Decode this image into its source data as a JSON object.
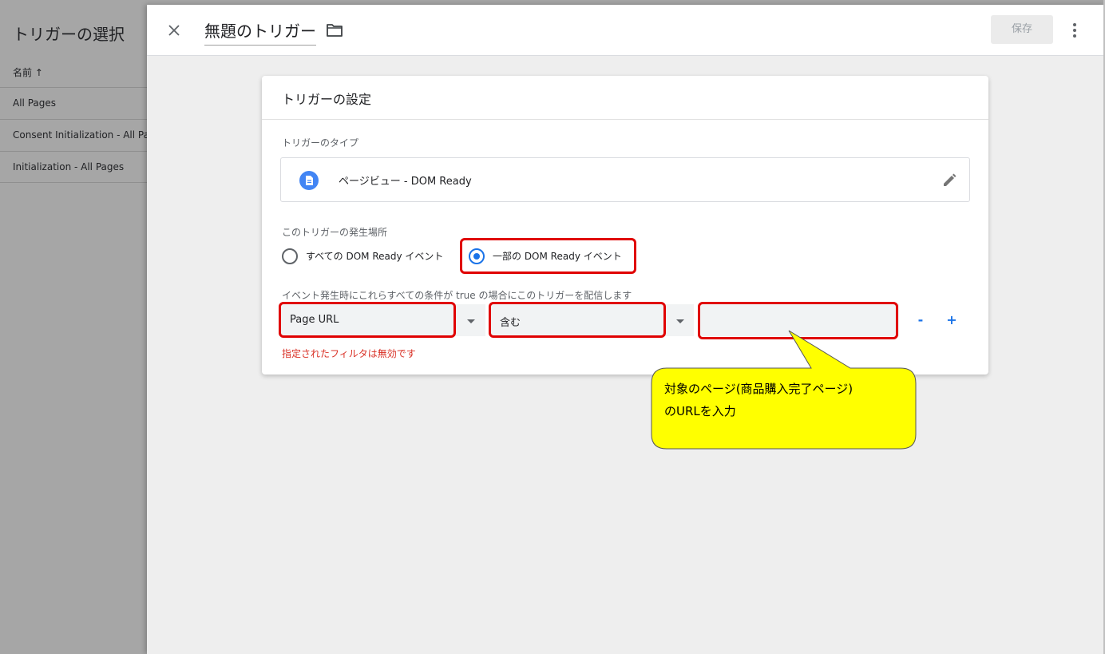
{
  "left_panel": {
    "title": "トリガーの選択",
    "column_header": "名前 ↑",
    "rows": [
      {
        "label": "All Pages"
      },
      {
        "label": "Consent Initialization - All Pages"
      },
      {
        "label": "Initialization - All Pages"
      }
    ]
  },
  "header": {
    "close_icon": "close-icon",
    "trigger_name": "無題のトリガー",
    "folder_icon": "folder-icon",
    "save_label": "保存",
    "more_icon": "more-vert-icon"
  },
  "card": {
    "title": "トリガーの設定",
    "type_label": "トリガーのタイプ",
    "type_value": "ページビュー - DOM Ready",
    "type_icon": "document-icon",
    "edit_icon": "pencil-icon",
    "fire_label": "このトリガーの発生場所",
    "radio_options": [
      {
        "label": "すべての DOM Ready イベント",
        "selected": false
      },
      {
        "label": "一部の DOM Ready イベント",
        "selected": true
      }
    ],
    "condition_label": "イベント発生時にこれらすべての条件が true の場合にこのトリガーを配信します",
    "condition": {
      "variable": "Page URL",
      "operator": "含む",
      "value": "",
      "remove_label": "-",
      "add_label": "+"
    },
    "error_text": "指定されたフィルタは無効です"
  },
  "callout": {
    "line1": "対象のページ(商品購入完了ページ)",
    "line2": "のURLを入力"
  },
  "colors": {
    "accent": "#1a73e8",
    "highlight": "#e00000",
    "error": "#d93025",
    "callout_fill": "#ffff00"
  }
}
